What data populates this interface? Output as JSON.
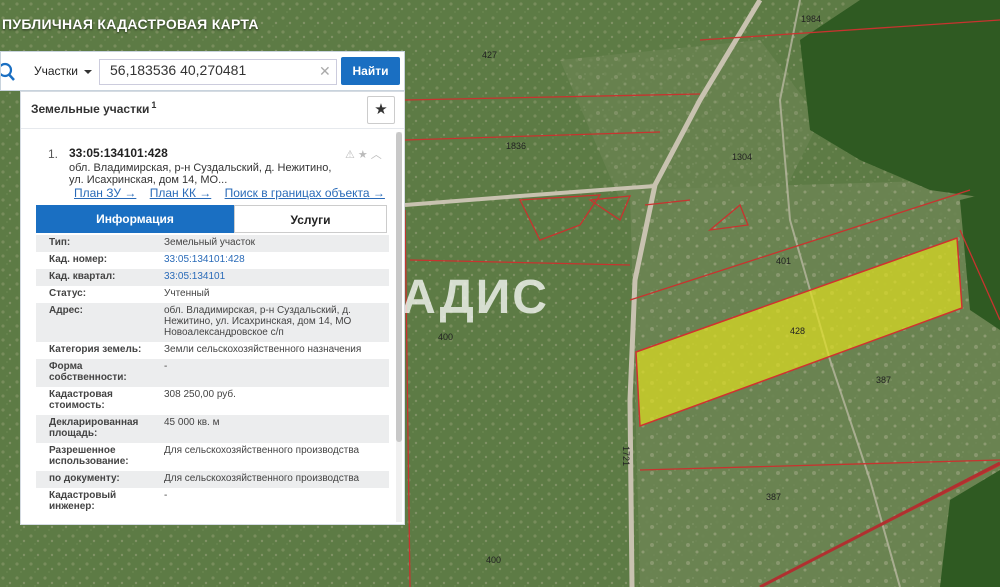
{
  "app": {
    "title": "ПУБЛИЧНАЯ КАДАСТРОВАЯ КАРТА"
  },
  "search": {
    "type_label": "Участки",
    "query": "56,183536 40,270481",
    "find_label": "Найти"
  },
  "panel": {
    "title": "Земельные участки",
    "count": "1",
    "result": {
      "num": "1.",
      "id": "33:05:134101:428",
      "address_lines": [
        "обл. Владимирская, р-н Суздальский, д. Нежитино,",
        "ул. Исахринская, дом 14, МО..."
      ],
      "links": [
        "План ЗУ →",
        "План КК →",
        "Поиск в границах объекта →"
      ]
    },
    "tabs": [
      "Информация",
      "Услуги"
    ],
    "rows": [
      {
        "k": [
          "Тип:"
        ],
        "v": [
          "Земельный участок"
        ]
      },
      {
        "k": [
          "Кад. номер:"
        ],
        "v": [
          "33:05:134101:428"
        ],
        "link": true
      },
      {
        "k": [
          "Кад. квартал:"
        ],
        "v": [
          "33:05:134101"
        ],
        "link": true
      },
      {
        "k": [
          "Статус:"
        ],
        "v": [
          "Учтенный"
        ]
      },
      {
        "k": [
          "Адрес:"
        ],
        "v": [
          "обл. Владимирская, р-н Суздальский, д.",
          "Нежитино, ул. Исахринская, дом 14, МО",
          "Новоалександровское с/п"
        ]
      },
      {
        "k": [
          "Категория земель:"
        ],
        "v": [
          "Земли сельскохозяйственного назначения"
        ]
      },
      {
        "k": [
          "Форма",
          "собственности:"
        ],
        "v": [
          "-"
        ]
      },
      {
        "k": [
          "Кадастровая",
          "стоимость:"
        ],
        "v": [
          "308 250,00 руб."
        ]
      },
      {
        "k": [
          "Декларированная",
          "площадь:"
        ],
        "v": [
          "45 000 кв. м"
        ]
      },
      {
        "k": [
          "Разрешенное",
          "использование:"
        ],
        "v": [
          "Для сельскохозяйственного производства"
        ]
      },
      {
        "k": [
          "по документу:"
        ],
        "v": [
          "Для сельскохозяйственного производства"
        ]
      },
      {
        "k": [
          "Кадастровый",
          "инженер:"
        ],
        "v": [
          "-"
        ]
      }
    ]
  },
  "map": {
    "parcel_labels": [
      "427",
      "1984",
      "1836",
      "1304",
      "401",
      "428",
      "400",
      "387",
      "387",
      "1721",
      "400"
    ],
    "highlight_color": "#e3e21e",
    "boundary_color": "#d0322f"
  },
  "watermark": {
    "text": "ВЛАДИС"
  }
}
